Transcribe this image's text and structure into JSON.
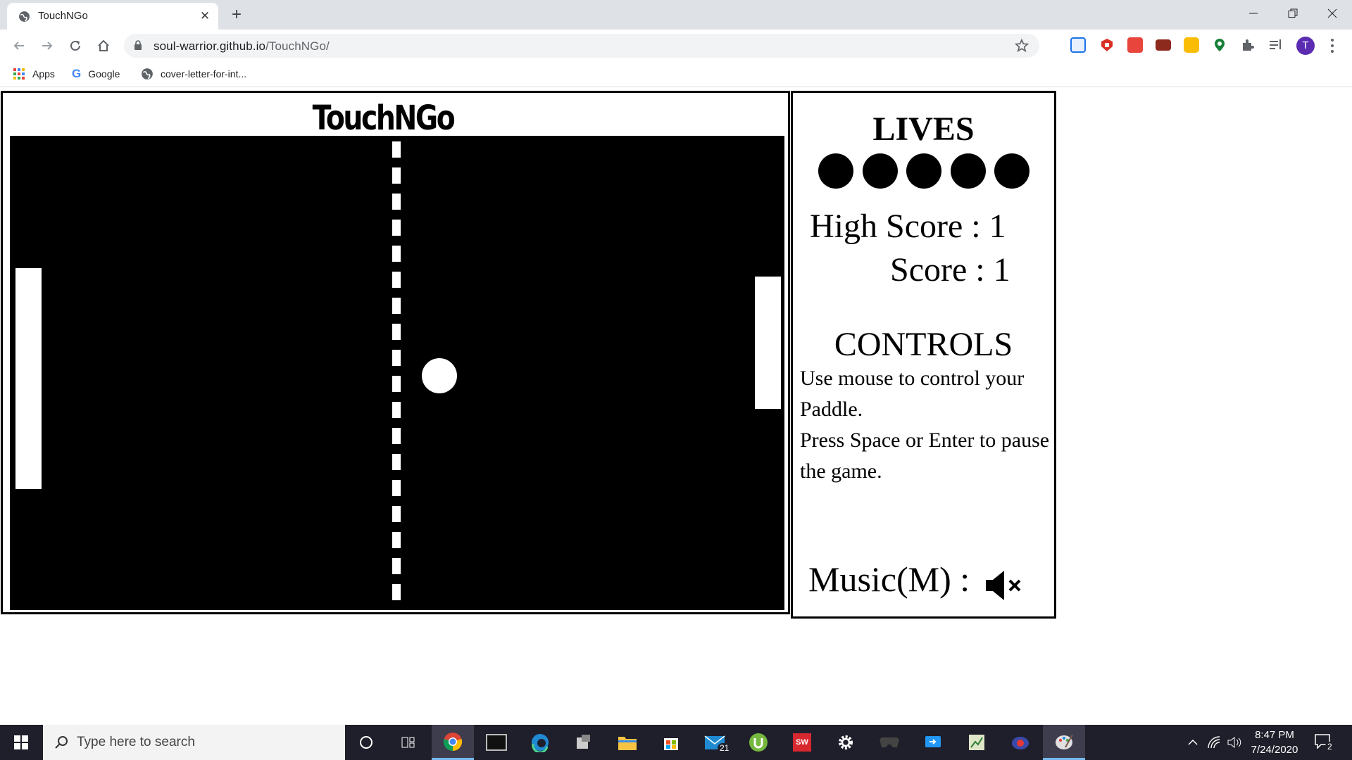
{
  "browser": {
    "tab_title": "TouchNGo",
    "url_host": "soul-warrior.github.io",
    "url_path": "/TouchNGo/",
    "profile_initial": "T",
    "bookmarks": [
      {
        "label": "Apps",
        "icon": "apps-grid-icon"
      },
      {
        "label": "Google",
        "icon": "google-icon"
      },
      {
        "label": "cover-letter-for-int...",
        "icon": "globe-icon"
      }
    ],
    "extensions": [
      {
        "icon": "extension-cast-icon",
        "color": "#1a73e8"
      },
      {
        "icon": "extension-shield-icon",
        "color": "#d93025"
      },
      {
        "icon": "extension-sql-icon",
        "color": "#e8453c"
      },
      {
        "icon": "extension-sol-icon",
        "color": "#8d2a1e"
      },
      {
        "icon": "extension-yellow-icon",
        "color": "#fbbc04"
      },
      {
        "icon": "extension-location-icon",
        "color": "#188038"
      },
      {
        "icon": "extensions-puzzle-icon",
        "color": "#5f6368"
      },
      {
        "icon": "media-queue-icon",
        "color": "#5f6368"
      }
    ]
  },
  "page": {
    "title": "TouchNGo",
    "lives_title": "LIVES",
    "lives_count": 5,
    "high_score": "High Score : 1",
    "score": "Score : 1",
    "controls_title": "CONTROLS",
    "controls_line1": "Use mouse to control your Paddle.",
    "controls_line2": "Press Space or Enter to pause the game.",
    "music_label": "Music(M) :",
    "music_state": "muted"
  },
  "taskbar": {
    "search_placeholder": "Type here to search",
    "time": "8:47 PM",
    "date": "7/24/2020",
    "mail_badge": "21",
    "notification_badge": "2"
  },
  "colors": {
    "court": "#000000",
    "paddle": "#ffffff",
    "ball": "#ffffff",
    "tabstrip": "#dee1e6",
    "taskbar": "#1f1f2b"
  }
}
